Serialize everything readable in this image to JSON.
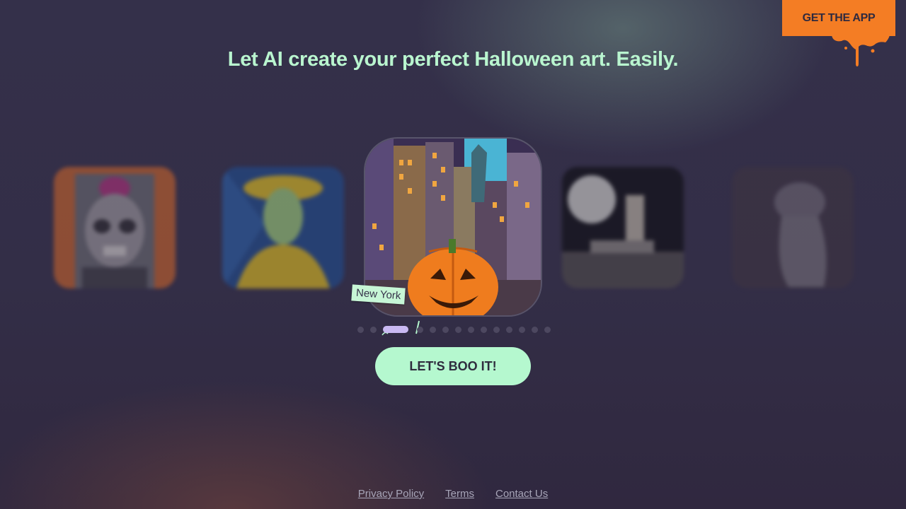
{
  "header": {
    "cta_label": "GET THE APP",
    "cta_color": "#f47d24",
    "headline": "Let AI create your perfect Halloween art. Easily."
  },
  "carousel": {
    "active_index": 1,
    "total_slides": 15,
    "slides": [
      {
        "name": "skull-portrait-image"
      },
      {
        "name": "scarecrow-painting-image"
      },
      {
        "name": "new-york-pumpkin-image",
        "tag": "New York"
      },
      {
        "name": "moon-skeleton-image"
      },
      {
        "name": "ghost-cat-image"
      }
    ]
  },
  "cta": {
    "label": "LET'S BOO IT!",
    "color": "#b5f8cf"
  },
  "footer": {
    "links": [
      "Privacy Policy",
      "Terms",
      "Contact Us"
    ]
  }
}
